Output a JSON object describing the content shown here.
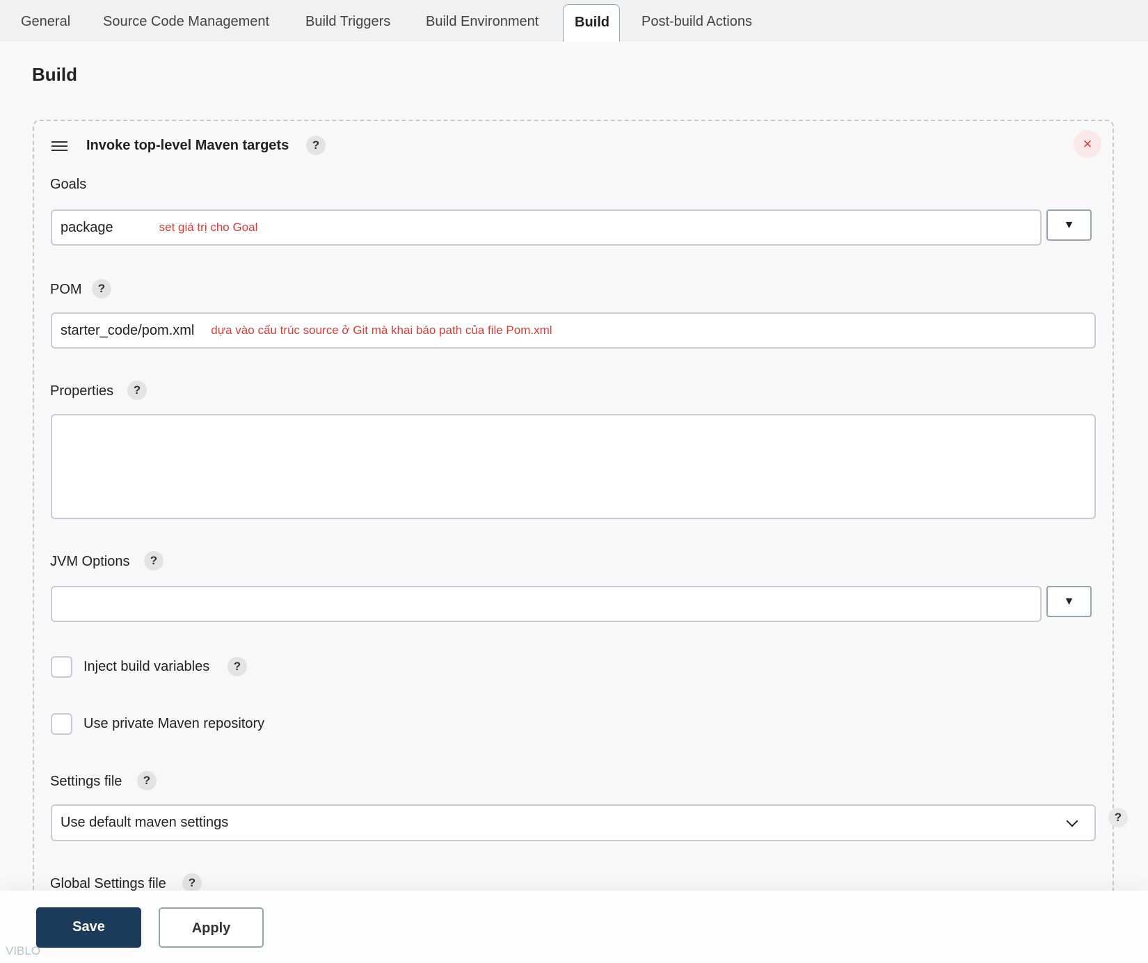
{
  "tabs": [
    "General",
    "Source Code Management",
    "Build Triggers",
    "Build Environment",
    "Build",
    "Post-build Actions"
  ],
  "section_title": "Build",
  "step": {
    "title": "Invoke top-level Maven targets",
    "goals": {
      "label": "Goals",
      "value": "package",
      "note": "set giá trị cho Goal"
    },
    "pom": {
      "label": "POM",
      "value": "starter_code/pom.xml",
      "note": "dựa vào cấu trúc source ở Git mà khai báo path của file Pom.xml"
    },
    "properties": {
      "label": "Properties",
      "value": ""
    },
    "jvm": {
      "label": "JVM Options",
      "value": ""
    },
    "inject": {
      "label": "Inject build variables",
      "checked": false
    },
    "private_repo": {
      "label": "Use private Maven repository",
      "checked": false
    },
    "settings": {
      "label": "Settings file",
      "value": "Use default maven settings"
    },
    "global_settings": {
      "label": "Global Settings file"
    }
  },
  "help": "?",
  "dropdown_glyph": "▼",
  "footer": {
    "save": "Save",
    "apply": "Apply"
  },
  "watermark": "VIBLO"
}
